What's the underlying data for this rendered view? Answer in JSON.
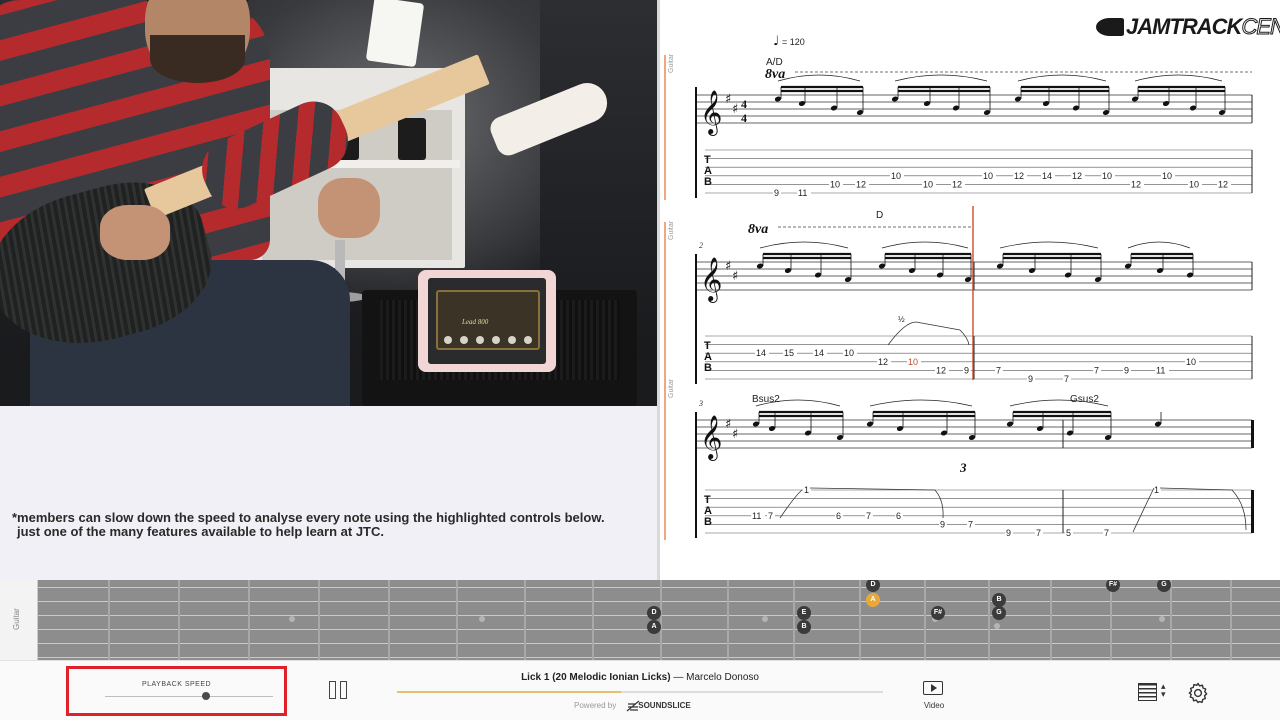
{
  "notice": {
    "line1": "*members can slow down the speed to analyse every note using the highlighted controls below.",
    "line2": "just one of the many features available to help learn at JTC."
  },
  "logo": {
    "part1": "JAMTRACK",
    "part2": "CENTRAL"
  },
  "video": {
    "tablet_amp_label": "Lead 800"
  },
  "score": {
    "instrument_label": "Guitar",
    "tempo": "= 120",
    "ottava": "8va",
    "time_signature": [
      "4",
      "4"
    ],
    "tab_letters": [
      "T",
      "A",
      "B"
    ],
    "systems": [
      {
        "measure_number": "",
        "chords": [
          {
            "name": "A/D"
          }
        ],
        "tab_numbers": [
          {
            "v": "9",
            "s": 5
          },
          {
            "v": "11",
            "s": 5
          },
          {
            "v": "10",
            "s": 4
          },
          {
            "v": "12",
            "s": 4
          },
          {
            "v": "10",
            "s": 3
          },
          {
            "v": "10",
            "s": 4
          },
          {
            "v": "12",
            "s": 4
          },
          {
            "v": "10",
            "s": 3
          },
          {
            "v": "12",
            "s": 3
          },
          {
            "v": "14",
            "s": 3
          },
          {
            "v": "12",
            "s": 3
          },
          {
            "v": "10",
            "s": 3
          },
          {
            "v": "12",
            "s": 4
          },
          {
            "v": "10",
            "s": 3
          },
          {
            "v": "10",
            "s": 4
          },
          {
            "v": "12",
            "s": 4
          }
        ]
      },
      {
        "measure_number": "2",
        "chords": [
          {
            "name": "D"
          }
        ],
        "bend": "½",
        "tab_numbers": [
          {
            "v": "14",
            "s": 2
          },
          {
            "v": "15",
            "s": 2
          },
          {
            "v": "14",
            "s": 2
          },
          {
            "v": "10",
            "s": 2
          },
          {
            "v": "12",
            "s": 3
          },
          {
            "v": "10",
            "s": 3
          },
          {
            "v": "12",
            "s": 4
          },
          {
            "v": "9",
            "s": 4
          },
          {
            "v": "7",
            "s": 4
          },
          {
            "v": "9",
            "s": 5
          },
          {
            "v": "7",
            "s": 5
          },
          {
            "v": "7",
            "s": 4
          },
          {
            "v": "9",
            "s": 4
          },
          {
            "v": "11",
            "s": 4
          },
          {
            "v": "10",
            "s": 3
          }
        ]
      },
      {
        "measure_number": "3",
        "chords": [
          {
            "name": "Bsus2"
          },
          {
            "name": "Gsus2"
          }
        ],
        "triplet": "3",
        "tab_numbers": [
          {
            "v": "11",
            "s": 3
          },
          {
            "v": "7",
            "s": 3
          },
          {
            "v": "1",
            "s": 0
          },
          {
            "v": "6",
            "s": 3
          },
          {
            "v": "7",
            "s": 3
          },
          {
            "v": "6",
            "s": 3
          },
          {
            "v": "9",
            "s": 4
          },
          {
            "v": "7",
            "s": 4
          },
          {
            "v": "9",
            "s": 5
          },
          {
            "v": "7",
            "s": 5
          },
          {
            "v": "5",
            "s": 5
          },
          {
            "v": "7",
            "s": 5
          },
          {
            "v": "1",
            "s": 0
          }
        ]
      }
    ]
  },
  "fretboard": {
    "instrument_label": "Guitar",
    "notes": [
      {
        "label": "D",
        "active": false
      },
      {
        "label": "A",
        "active": false
      },
      {
        "label": "E",
        "active": false
      },
      {
        "label": "B",
        "active": false
      },
      {
        "label": "D",
        "active": false
      },
      {
        "label": "A",
        "active": true
      },
      {
        "label": "F#",
        "active": false
      },
      {
        "label": "B",
        "active": false
      },
      {
        "label": "G",
        "active": false
      },
      {
        "label": "F#",
        "active": false
      },
      {
        "label": "G",
        "active": false
      }
    ]
  },
  "controls": {
    "speed_label": "PLAYBACK SPEED",
    "speed_value": 0.6,
    "title": "Lick 1 (20 Melodic Ionian Licks)",
    "separator": " — ",
    "artist": "Marcelo Donoso",
    "progress": 0.46,
    "powered_by": "Powered by",
    "brand": "SOUNDSLICE",
    "video_label": "Video",
    "highlight_color": "#e0212a"
  }
}
